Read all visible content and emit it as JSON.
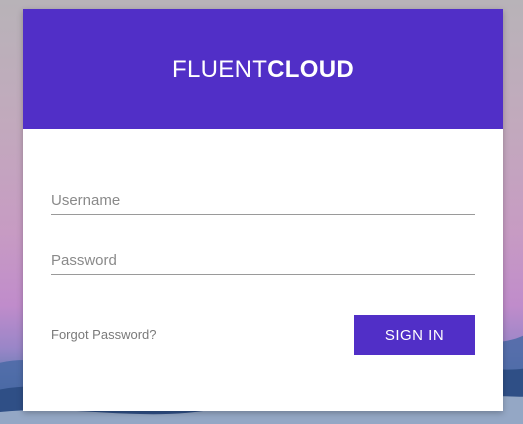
{
  "brand": {
    "light": "FLUENT",
    "bold": "CLOUD"
  },
  "form": {
    "username_placeholder": "Username",
    "password_placeholder": "Password",
    "forgot_label": "Forgot Password?",
    "signin_label": "SIGN IN"
  },
  "colors": {
    "accent": "#512fc7",
    "card": "#ffffff"
  }
}
